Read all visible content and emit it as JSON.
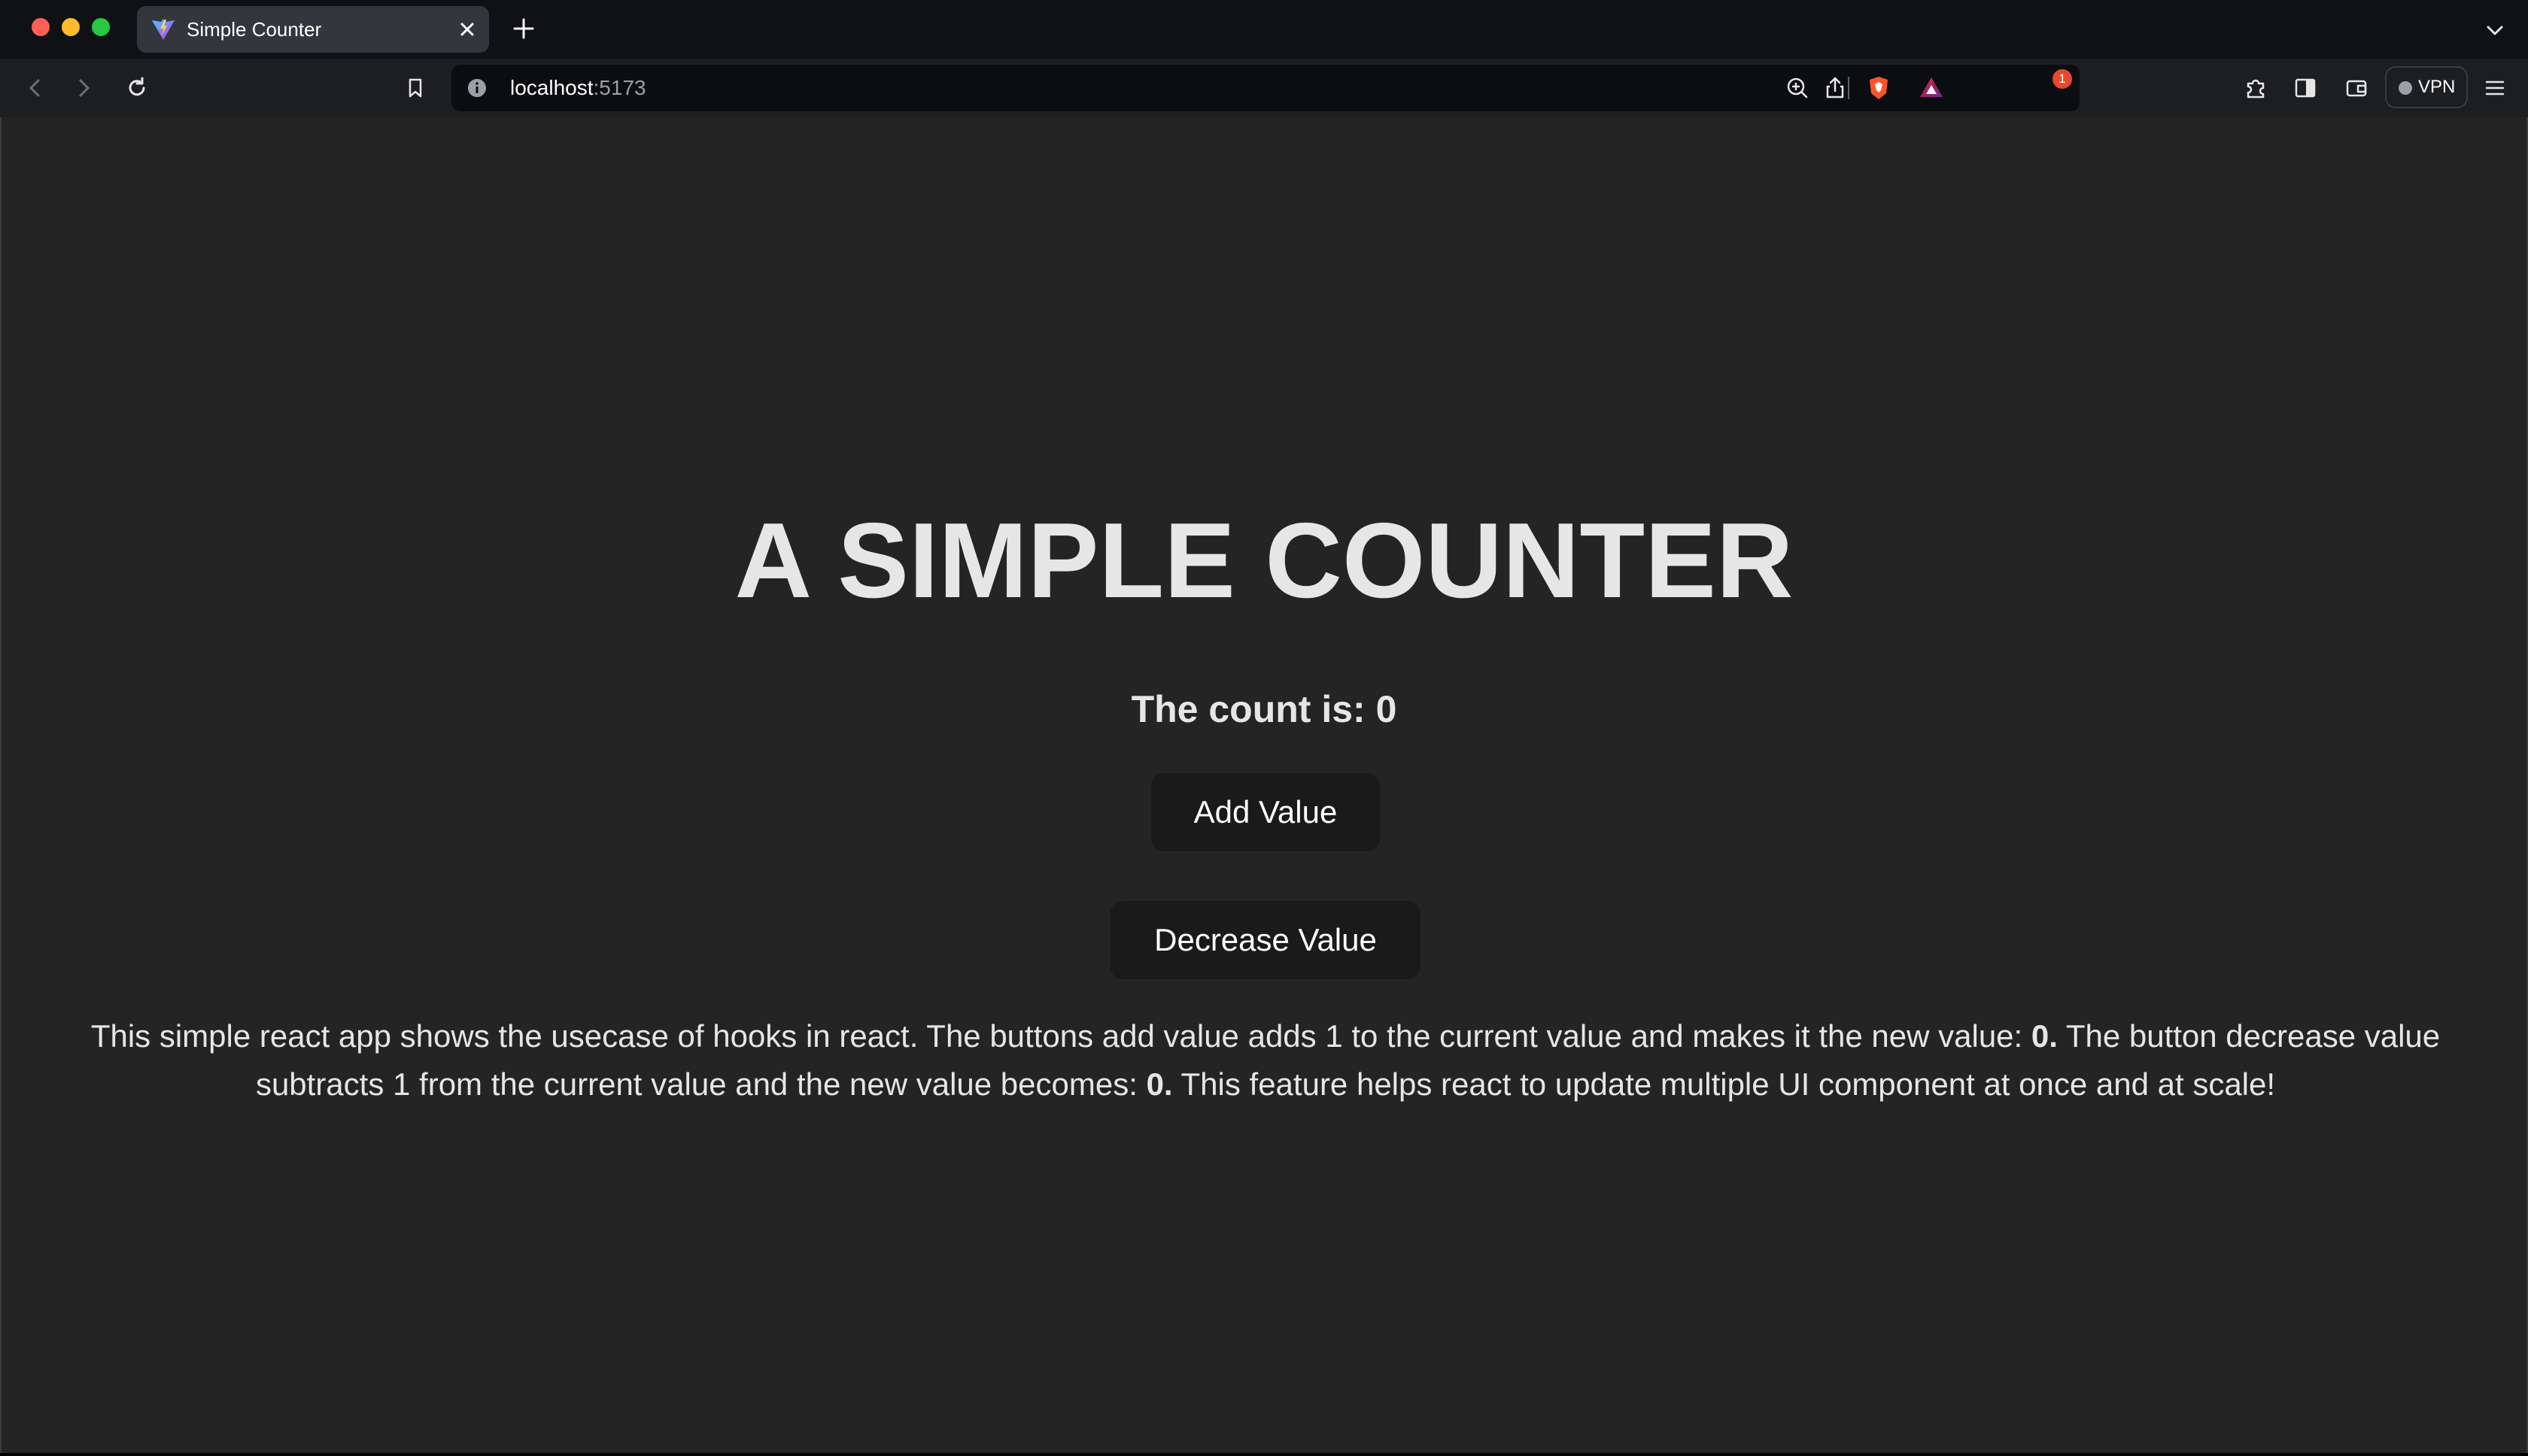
{
  "browser": {
    "tab": {
      "title": "Simple Counter",
      "favicon": "vite-logo-icon"
    },
    "url": {
      "host": "localhost",
      "port": ":5173"
    },
    "notification_badge": "1",
    "vpn_label": "VPN",
    "toolbar_icons": [
      "back-icon",
      "forward-icon",
      "reload-icon",
      "bookmark-icon",
      "info-icon",
      "zoom-icon",
      "share-icon",
      "brave-shields-icon",
      "brave-rewards-icon",
      "extensions-icon",
      "sidebar-icon",
      "wallet-icon",
      "menu-icon"
    ]
  },
  "app": {
    "title": "A SIMPLE COUNTER",
    "count_label": "The count is: 0",
    "add_button": "Add Value",
    "decrease_button": "Decrease Value",
    "description": {
      "part1": "This simple react app shows the usecase of hooks in react. The buttons add value adds 1 to the current value and makes it the new value: ",
      "value1": "0.",
      "part2": " The button decrease value subtracts 1 from the current value and the new value becomes: ",
      "value2": "0.",
      "part3": " This feature helps react to update multiple UI component at once and at scale!"
    }
  },
  "colors": {
    "page_background": "#242424",
    "text": "#e6e6e6",
    "button_background": "#1a1a1a",
    "tabbar": "#0f1115",
    "toolbar": "#1c1e22"
  }
}
